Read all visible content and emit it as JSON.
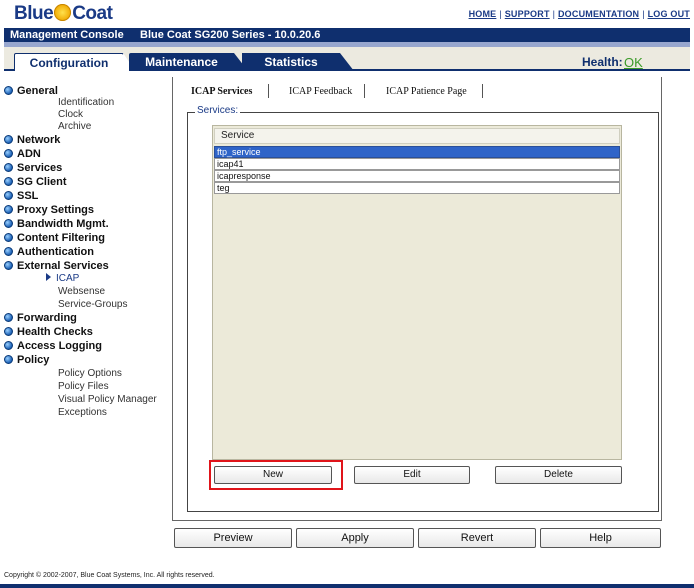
{
  "brand": {
    "logo_left": "Blue",
    "logo_right": "Coat"
  },
  "top_links": [
    "HOME",
    "SUPPORT",
    "DOCUMENTATION",
    "LOG OUT"
  ],
  "title_bar": {
    "console": "Management Console",
    "model": "Blue Coat SG200 Series - 10.0.20.6"
  },
  "main_tabs": [
    "Configuration",
    "Maintenance",
    "Statistics"
  ],
  "active_main_tab": "Configuration",
  "health": {
    "label": "Health:",
    "value": "OK"
  },
  "sidebar": {
    "general": "General",
    "identification": "Identification",
    "clock": "Clock",
    "archive": "Archive",
    "network": "Network",
    "adn": "ADN",
    "services": "Services",
    "sg_client": "SG Client",
    "ssl": "SSL",
    "proxy_settings": "Proxy Settings",
    "bandwidth": "Bandwidth Mgmt.",
    "content_filtering": "Content Filtering",
    "authentication": "Authentication",
    "external_services": "External Services",
    "icap": "ICAP",
    "websense": "Websense",
    "service_groups": "Service-Groups",
    "forwarding": "Forwarding",
    "health_checks": "Health Checks",
    "access_logging": "Access Logging",
    "policy": "Policy",
    "policy_options": "Policy Options",
    "policy_files": "Policy Files",
    "vpm": "Visual Policy Manager",
    "exceptions": "Exceptions"
  },
  "content_tabs": [
    "ICAP Services",
    "ICAP Feedback",
    "ICAP Patience Page"
  ],
  "services_legend": "Services:",
  "list": {
    "header": "Service",
    "rows": [
      "ftp_service",
      "icap41",
      "icapresponse",
      "teg"
    ],
    "selected": "ftp_service"
  },
  "list_buttons": {
    "new": "New",
    "edit": "Edit",
    "delete": "Delete"
  },
  "bottom_buttons": {
    "preview": "Preview",
    "apply": "Apply",
    "revert": "Revert",
    "help": "Help"
  },
  "footer": "Copyright © 2002-2007, Blue Coat Systems, Inc. All rights reserved.",
  "colors": {
    "navy": "#0f2f6e",
    "selected_row": "#2f64c8",
    "highlight": "#e0141a",
    "ok_green": "#3a9a28"
  }
}
